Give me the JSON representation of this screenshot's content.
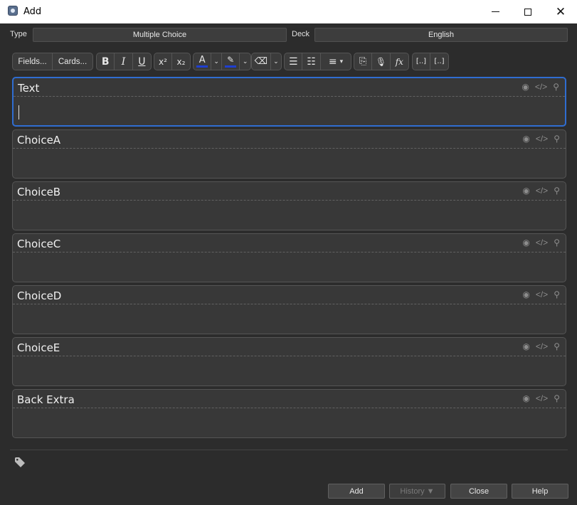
{
  "window": {
    "title": "Add",
    "min_glyph": "",
    "max_glyph": "",
    "close_glyph": "✕"
  },
  "note_type": {
    "label": "Type",
    "value": "Multiple Choice"
  },
  "deck": {
    "label": "Deck",
    "value": "English"
  },
  "toolbar": {
    "fields_label": "Fields...",
    "cards_label": "Cards...",
    "bold": "B",
    "italic": "I",
    "underline": "U",
    "superscript": "x²",
    "subscript": "x₂",
    "text_color_glyph": "A",
    "dropdown_glyph": "⌄",
    "highlight_glyph": "✎",
    "eraser_glyph": "⌫",
    "ul_glyph": "☰",
    "ol_glyph": "☷",
    "align_glyph": "≡",
    "attach_glyph": "⎘",
    "record_glyph": "🎙",
    "math_glyph": "fx",
    "cloze_glyph": "[..]",
    "cloze_same_glyph": "[..]",
    "accent_color": "#1f3fd0"
  },
  "fields": [
    {
      "name": "Text",
      "focused": true
    },
    {
      "name": "ChoiceA",
      "focused": false
    },
    {
      "name": "ChoiceB",
      "focused": false
    },
    {
      "name": "ChoiceC",
      "focused": false
    },
    {
      "name": "ChoiceD",
      "focused": false
    },
    {
      "name": "ChoiceE",
      "focused": false
    },
    {
      "name": "Back Extra",
      "focused": false
    }
  ],
  "field_icons": {
    "eye": "◉",
    "html": "</>",
    "pin": "⚲"
  },
  "buttons": {
    "add": "Add",
    "history": "History ▼",
    "close": "Close",
    "help": "Help"
  }
}
